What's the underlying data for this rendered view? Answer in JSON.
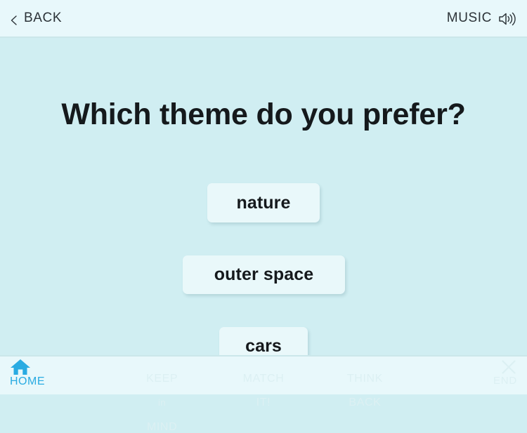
{
  "header": {
    "back_label": "BACK",
    "back_icon": "chevron-left-icon",
    "music_label": "MUSIC",
    "music_icon": "speaker-volume-icon"
  },
  "main": {
    "question": "Which theme do you prefer?",
    "choices": [
      {
        "label": "nature"
      },
      {
        "label": "outer space"
      },
      {
        "label": "cars"
      }
    ]
  },
  "bottom_nav": {
    "items": [
      {
        "label": "HOME",
        "icon": "home-icon",
        "active": true
      },
      {
        "line1": "KEEP",
        "line2": "in",
        "line3": "MIND",
        "active": false
      },
      {
        "line1": "MATCH",
        "line2": "IT!",
        "active": false
      },
      {
        "line1": "THINK",
        "line2": "BACK",
        "active": false
      },
      {
        "label": "END",
        "icon": "close-x-icon",
        "active": false
      }
    ]
  },
  "colors": {
    "header_bg": "#e8f8fb",
    "main_bg": "#d0eef2",
    "button_bg": "#e9f8fa",
    "text": "#15191c",
    "accent_blue": "#29abe2",
    "nav_disabled": "#dcf0f3"
  }
}
